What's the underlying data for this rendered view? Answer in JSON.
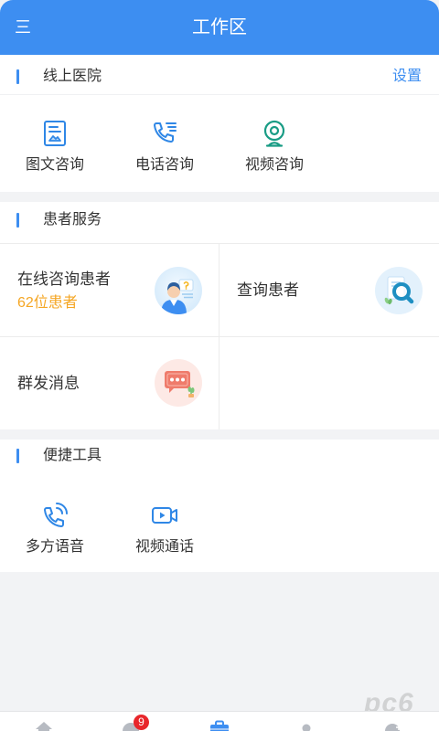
{
  "header": {
    "menu_label": "三",
    "title": "工作区"
  },
  "online_hospital": {
    "title": "线上医院",
    "settings_label": "设置",
    "items": [
      {
        "label": "图文咨询",
        "icon": "image-text-consult-icon"
      },
      {
        "label": "电话咨询",
        "icon": "phone-consult-icon"
      },
      {
        "label": "视频咨询",
        "icon": "video-consult-icon"
      }
    ]
  },
  "patient_services": {
    "title": "患者服务",
    "cells": [
      {
        "label": "在线咨询患者",
        "sublabel": "62位患者",
        "icon": "doctor-consult-icon"
      },
      {
        "label": "查询患者",
        "icon": "search-patient-icon"
      },
      {
        "label": "群发消息",
        "icon": "group-message-icon"
      }
    ]
  },
  "tools": {
    "title": "便捷工具",
    "items": [
      {
        "label": "多方语音",
        "icon": "multi-party-voice-icon"
      },
      {
        "label": "视频通话",
        "icon": "video-call-icon"
      }
    ]
  },
  "tab_bar": {
    "items": [
      {
        "icon": "home-icon",
        "active": false
      },
      {
        "icon": "message-icon",
        "active": false,
        "badge": "9"
      },
      {
        "icon": "briefcase-icon",
        "active": true
      },
      {
        "icon": "person-icon",
        "active": false
      },
      {
        "icon": "person-add-icon",
        "active": false
      }
    ]
  },
  "watermark": "pc6",
  "colors": {
    "primary": "#3d8ef1",
    "sublabel_orange": "#f5a623",
    "video_icon_teal": "#199c85",
    "badge_red": "#e8262b",
    "page_background": "#f2f3f5"
  }
}
